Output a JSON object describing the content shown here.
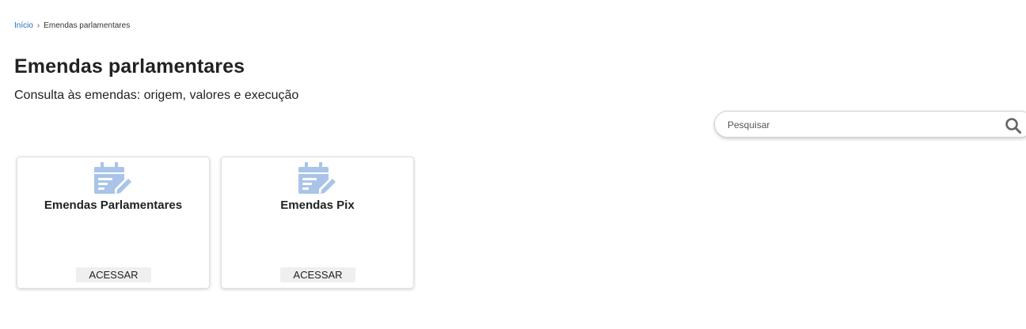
{
  "breadcrumb": {
    "home": "Início",
    "current": "Emendas parlamentares"
  },
  "header": {
    "title": "Emendas parlamentares",
    "subtitle": "Consulta às emendas: origem, valores e execução"
  },
  "search": {
    "placeholder": "Pesquisar"
  },
  "cards": [
    {
      "icon": "calendar-edit-icon",
      "title": "Emendas Parlamentares",
      "button": "ACESSAR"
    },
    {
      "icon": "calendar-edit-icon",
      "title": "Emendas Pix",
      "button": "ACESSAR"
    }
  ],
  "colors": {
    "link": "#1e6bb8",
    "icon": "#a9c4e8",
    "button_bg": "#efefef"
  }
}
